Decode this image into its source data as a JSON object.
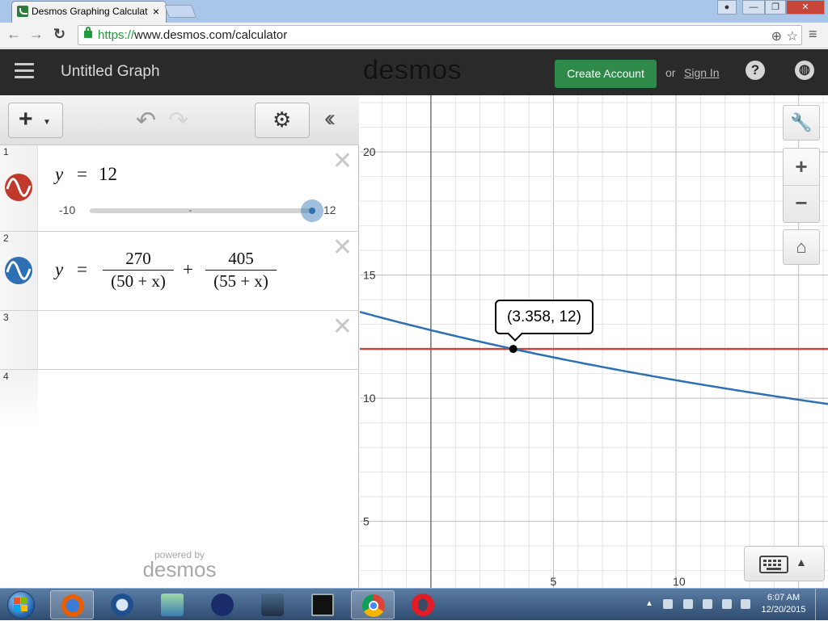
{
  "browser": {
    "tab_title": "Desmos Graphing Calculat",
    "url_scheme": "https://",
    "url_rest": "www.desmos.com/calculator"
  },
  "header": {
    "graph_title": "Untitled Graph",
    "logo": "desmos",
    "create_account": "Create Account",
    "or": "or",
    "sign_in": "Sign In",
    "help": "?"
  },
  "expressions": [
    {
      "num": "1",
      "lhs": "y",
      "eq": "=",
      "rhs": "12",
      "color": "#c0392b",
      "slider": {
        "min": "-10",
        "max": "12",
        "value_fraction": 1.0
      }
    },
    {
      "num": "2",
      "lhs": "y",
      "eq": "=",
      "color": "#2d70b3",
      "f1_num": "270",
      "f1_den": "(50 + x)",
      "plus": "+",
      "f2_num": "405",
      "f2_den": "(55 + x)"
    },
    {
      "num": "3"
    },
    {
      "num": "4"
    }
  ],
  "branding": {
    "powered_by": "powered by",
    "name": "desmos"
  },
  "graph": {
    "tooltip": "(3.358, 12)",
    "y_ticks": [
      "20",
      "15",
      "10",
      "5"
    ],
    "x_ticks": [
      "5",
      "10"
    ],
    "line_colors": {
      "red": "#c74440",
      "blue": "#2d70b3"
    },
    "y_range": [
      2.3,
      22.3
    ],
    "x_range": [
      -2.9,
      16.2
    ]
  },
  "taskbar": {
    "time": "6:07 AM",
    "date": "12/20/2015"
  }
}
